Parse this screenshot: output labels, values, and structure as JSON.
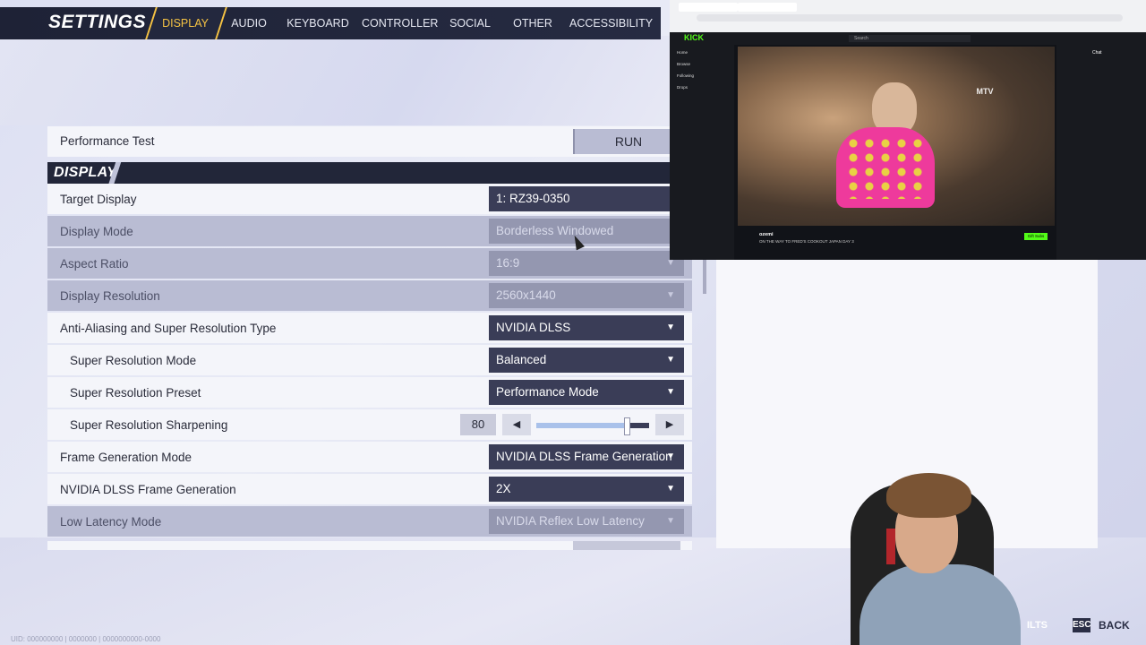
{
  "header": {
    "title": "SETTINGS",
    "tabs": [
      {
        "label": "DISPLAY",
        "active": true
      },
      {
        "label": "AUDIO"
      },
      {
        "label": "KEYBOARD"
      },
      {
        "label": "CONTROLLER"
      },
      {
        "label": "SOCIAL"
      },
      {
        "label": "OTHER"
      },
      {
        "label": "ACCESSIBILITY"
      }
    ]
  },
  "performance": {
    "label": "Performance Test",
    "button": "RUN"
  },
  "section": {
    "title": "DISPLAY"
  },
  "settings": [
    {
      "label": "Target Display",
      "value": "1: RZ39-0350",
      "dim": false
    },
    {
      "label": "Display Mode",
      "value": "Borderless Windowed",
      "dim": true
    },
    {
      "label": "Aspect Ratio",
      "value": "16:9",
      "dim": true
    },
    {
      "label": "Display Resolution",
      "value": "2560x1440",
      "dim": true
    },
    {
      "label": "Anti-Aliasing and Super Resolution Type",
      "value": "NVIDIA DLSS",
      "dim": false
    },
    {
      "label": "Super Resolution Mode",
      "value": "Balanced",
      "dim": false
    },
    {
      "label": "Super Resolution Preset",
      "value": "Performance Mode",
      "dim": false
    },
    {
      "label": "Super Resolution Sharpening",
      "value": "80",
      "dim": false,
      "fraction": 0.8
    },
    {
      "label": "Frame Generation Mode",
      "value": "NVIDIA DLSS Frame Generation",
      "dim": false
    },
    {
      "label": "NVIDIA DLSS Frame Generation",
      "value": "2X",
      "dim": false
    },
    {
      "label": "Low Latency Mode",
      "value": "NVIDIA Reflex Low Latency",
      "dim": true
    }
  ],
  "stream": {
    "logo": "KICK",
    "search": "Search",
    "streamer": "ozemi",
    "title": "ON THE WAY TO FRED'S COOKOUT JAPAN DAY 3",
    "follow": "Gift Subs",
    "chat_title": "Chat",
    "watermark": "MTV",
    "side_items": [
      "Home",
      "Browse",
      "Following",
      "Drops"
    ]
  },
  "footer": {
    "user_id": "UID: 000000000 | 0000000 | 0000000000-0000",
    "esc_key": "ESC",
    "back_label": "BACK",
    "partial_label": "ILTS"
  },
  "colors": {
    "accent": "#f6c343",
    "panel": "#f4f5fa",
    "dropdown": "#3a3d57",
    "kick_green": "#53fc18"
  }
}
